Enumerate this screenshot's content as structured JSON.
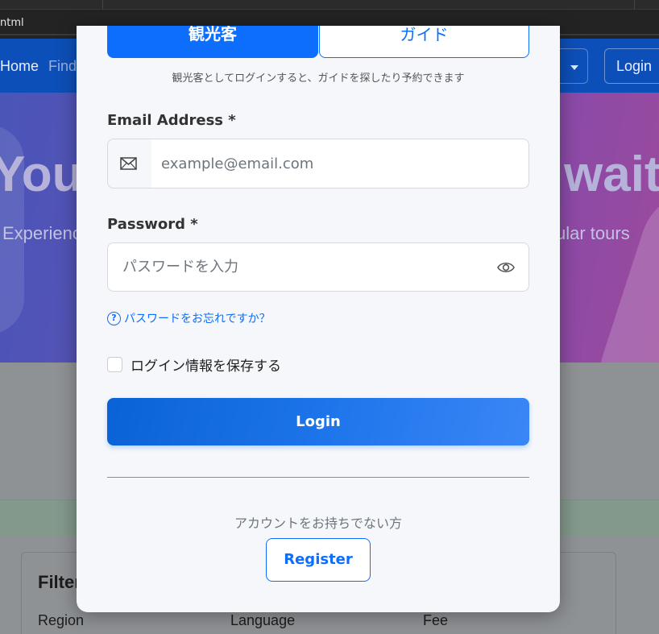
{
  "browser": {
    "url_fragment": "ntml"
  },
  "site": {
    "nav": {
      "home": "Home",
      "find": "Find",
      "dropdown_label": "n",
      "login": "Login"
    },
    "hero": {
      "title_left": "You",
      "title_right": "waits",
      "subtitle_left": "Experience",
      "subtitle_right": "ular tours"
    },
    "filters": {
      "title": "Filter",
      "region": "Region",
      "language": "Language",
      "fee": "Fee"
    }
  },
  "modal": {
    "tabs": {
      "tourist": "観光客",
      "guide": "ガイド"
    },
    "role_hint": "観光客としてログインすると、ガイドを探したり予約できます",
    "email": {
      "label": "Email Address *",
      "placeholder": "example@email.com",
      "icon": "envelope-icon"
    },
    "password": {
      "label": "Password *",
      "placeholder": "パスワードを入力",
      "icon": "eye-icon"
    },
    "forgot_password": "パスワードをお忘れですか？",
    "remember_me": "ログイン情報を保存する",
    "login_button": "Login",
    "no_account": "アカウントをお持ちでない方",
    "register_button": "Register"
  },
  "colors": {
    "primary": "#0d6efd",
    "navbar": "#0d4fb8",
    "modal_bg": "#f5f7fa"
  }
}
